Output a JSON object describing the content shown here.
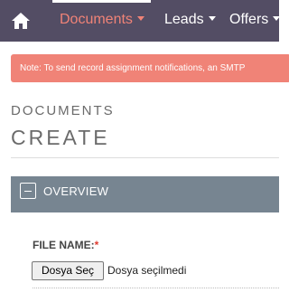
{
  "navbar": {
    "home_icon": "home-icon",
    "items": [
      {
        "label": "Documents",
        "active": true
      },
      {
        "label": "Leads",
        "active": false
      },
      {
        "label": "Offers",
        "active": false
      }
    ],
    "colors": {
      "background": "#534d64",
      "active": "#f08377"
    }
  },
  "alert": {
    "text": "Note: To send record assignment notifications, an SMTP"
  },
  "header": {
    "module": "DOCUMENTS",
    "action": "CREATE"
  },
  "panel": {
    "title": "OVERVIEW",
    "toggle_icon": "collapse-minus-icon",
    "header_color": "#778591"
  },
  "fields": {
    "file_name": {
      "label": "FILE NAME:",
      "required_mark": "*",
      "button_label": "Dosya Seç",
      "status": "Dosya seçilmedi"
    }
  }
}
